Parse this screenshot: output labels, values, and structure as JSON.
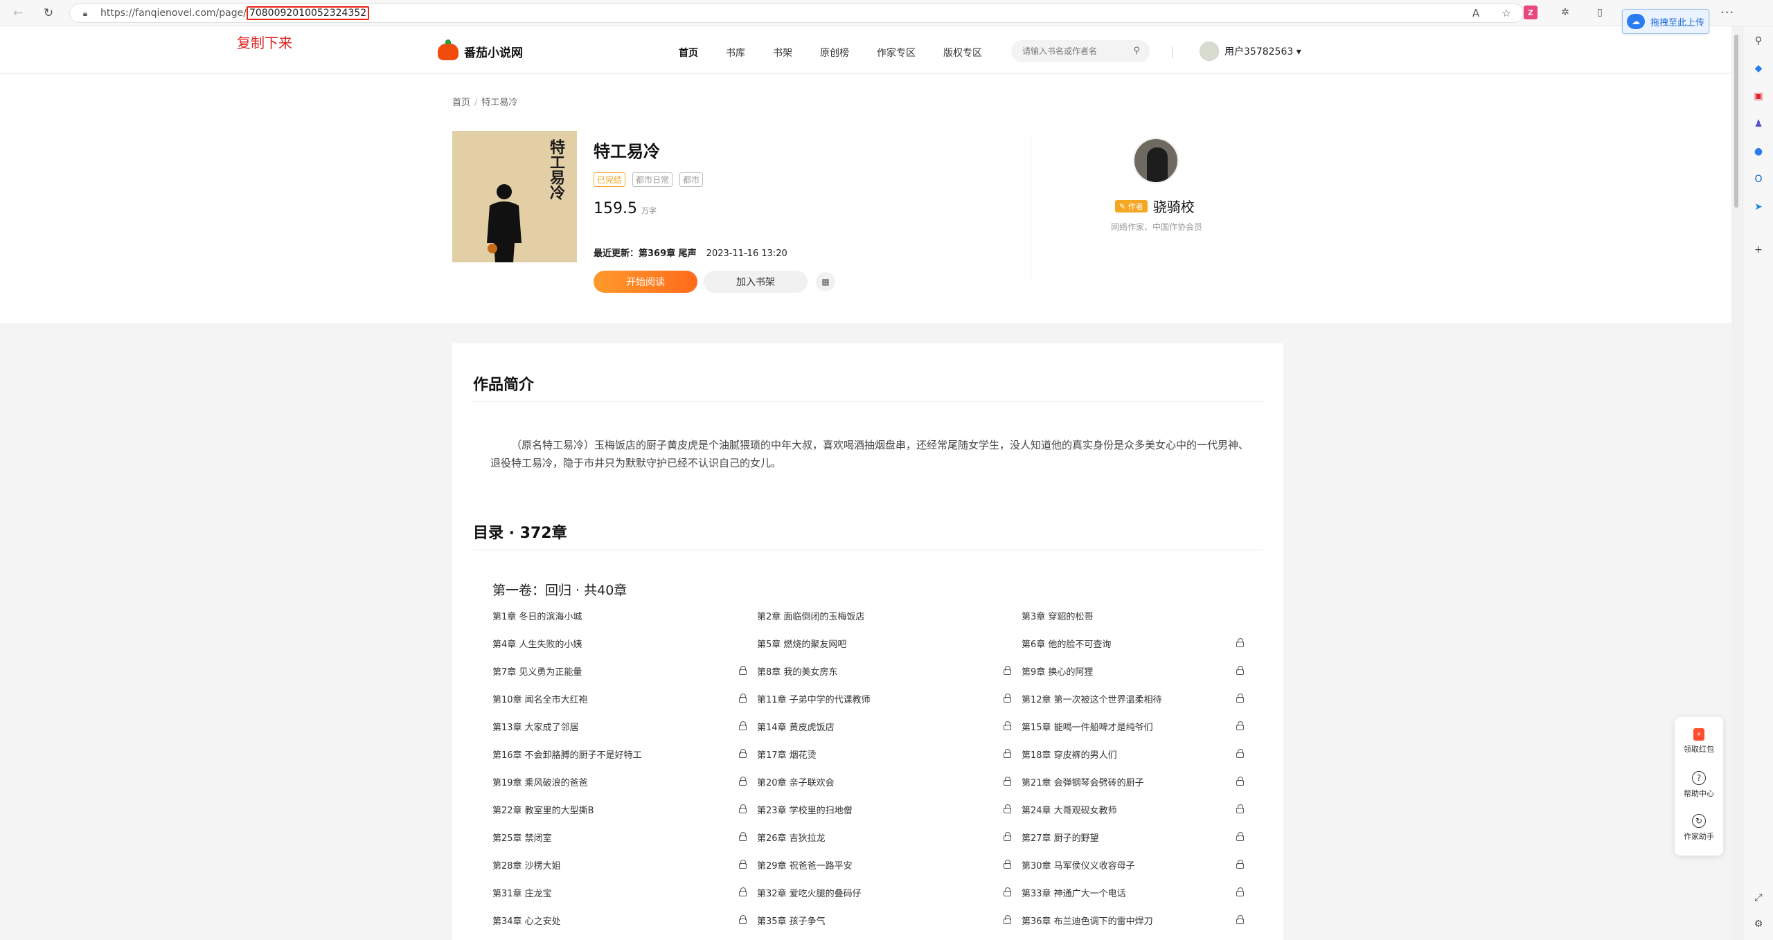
{
  "browser": {
    "url_base": "https://fanqienovel.com/page/",
    "url_id": "7080092010052324352",
    "upload_button": "拖拽至此上传",
    "more": "···"
  },
  "annotation": "复制下来",
  "site": {
    "logo_text": "番茄小说网",
    "nav": [
      "首页",
      "书库",
      "书架",
      "原创榜",
      "作家专区",
      "版权专区"
    ],
    "search_placeholder": "请输入书名或作者名",
    "user_name": "用户35782563 ▾"
  },
  "breadcrumb": [
    "首页",
    "特工易冷"
  ],
  "book": {
    "cover_title": "特工易冷",
    "title": "特工易冷",
    "tags": [
      "已完结",
      "都市日常",
      "都市"
    ],
    "word_count": "159.5",
    "word_unit": "万字",
    "latest_label": "最近更新：第369章 尾声",
    "latest_time": "2023-11-16 13:20",
    "read_button": "开始阅读",
    "shelf_button": "加入书架",
    "qr_icon": "qr-code-icon"
  },
  "author": {
    "badge": "✎ 作者",
    "name": "骁骑校",
    "desc": "网络作家、中国作协会员"
  },
  "intro": {
    "title": "作品简介",
    "text": "（原名特工易冷）玉梅饭店的厨子黄皮虎是个油腻猥琐的中年大叔，喜欢喝酒抽烟盘串，还经常尾随女学生，没人知道他的真实身份是众多美女心中的一代男神、退役特工易冷，隐于市井只为默默守护已经不认识自己的女儿。"
  },
  "catalog": {
    "title": "目录 · 372章",
    "volume": "第一卷：回归 · 共40章",
    "chapters": [
      {
        "title": "第1章 冬日的滨海小城",
        "locked": false
      },
      {
        "title": "第2章 面临倒闭的玉梅饭店",
        "locked": false
      },
      {
        "title": "第3章 穿貂的松哥",
        "locked": false
      },
      {
        "title": "第4章 人生失败的小姨",
        "locked": false
      },
      {
        "title": "第5章 燃烧的聚友网吧",
        "locked": false
      },
      {
        "title": "第6章 他的脸不可查询",
        "locked": true
      },
      {
        "title": "第7章 见义勇为正能量",
        "locked": true
      },
      {
        "title": "第8章 我的美女房东",
        "locked": true
      },
      {
        "title": "第9章 换心的阿狸",
        "locked": true
      },
      {
        "title": "第10章 闻名全市大红袍",
        "locked": true
      },
      {
        "title": "第11章 子弟中学的代课教师",
        "locked": true
      },
      {
        "title": "第12章 第一次被这个世界温柔相待",
        "locked": true
      },
      {
        "title": "第13章 大家成了邻居",
        "locked": true
      },
      {
        "title": "第14章 黄皮虎饭店",
        "locked": true
      },
      {
        "title": "第15章 能喝一件船啤才是纯爷们",
        "locked": true
      },
      {
        "title": "第16章 不会卸胳膊的厨子不是好特工",
        "locked": true
      },
      {
        "title": "第17章 烟花烫",
        "locked": true
      },
      {
        "title": "第18章 穿皮裤的男人们",
        "locked": true
      },
      {
        "title": "第19章 乘风破浪的爸爸",
        "locked": true
      },
      {
        "title": "第20章 亲子联欢会",
        "locked": true
      },
      {
        "title": "第21章 会弹钢琴会劈砖的厨子",
        "locked": true
      },
      {
        "title": "第22章 教室里的大型撕B",
        "locked": true
      },
      {
        "title": "第23章 学校里的扫地僧",
        "locked": true
      },
      {
        "title": "第24章 大哥观砚女教师",
        "locked": true
      },
      {
        "title": "第25章 禁闭室",
        "locked": true
      },
      {
        "title": "第26章 吉狄拉龙",
        "locked": true
      },
      {
        "title": "第27章 厨子的野望",
        "locked": true
      },
      {
        "title": "第28章 沙楞大姐",
        "locked": true
      },
      {
        "title": "第29章 祝爸爸一路平安",
        "locked": true
      },
      {
        "title": "第30章 马军侯仪义收容母子",
        "locked": true
      },
      {
        "title": "第31章 庄龙宝",
        "locked": true
      },
      {
        "title": "第32章 爱吃火腿的叠码仔",
        "locked": true
      },
      {
        "title": "第33章 神通广大一个电话",
        "locked": true
      },
      {
        "title": "第34章 心之安处",
        "locked": true
      },
      {
        "title": "第35章 孩子争气",
        "locked": true
      },
      {
        "title": "第36章 布兰迪色调下的雷中焊刀",
        "locked": true
      }
    ]
  },
  "float_panel": [
    "领取红包",
    "帮助中心",
    "作家助手"
  ]
}
